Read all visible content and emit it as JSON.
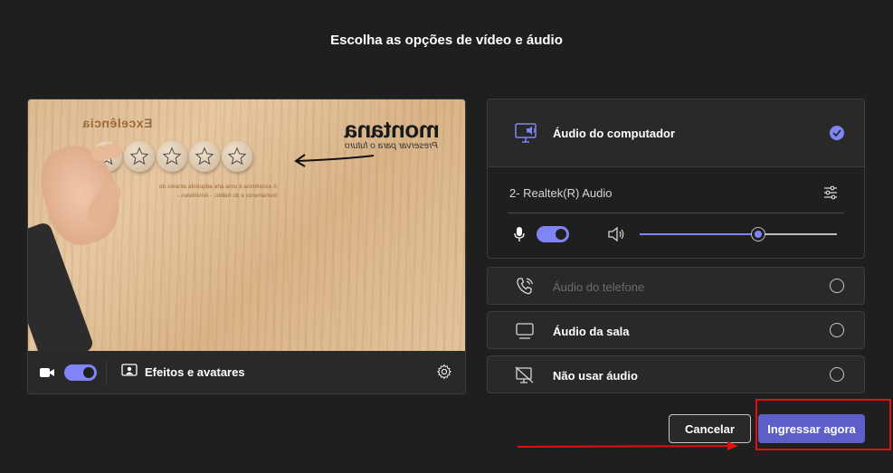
{
  "title": "Escolha as opções de vídeo e áudio",
  "video": {
    "preview_text": {
      "heading": "Excelência",
      "brand": "montana",
      "tagline": "Preservar para o futuro",
      "quote": "A excelência é uma arte adquirida através do treinamento e do hábito. - Aristóteles -"
    },
    "camera_toggle": "on",
    "effects_label": "Efeitos e avatares"
  },
  "audio": {
    "computer": {
      "label": "Áudio do computador",
      "selected": true
    },
    "device": "2- Realtek(R) Audio",
    "mic_toggle": "on",
    "speaker_volume": 0.6,
    "options": [
      {
        "label": "Áudio do telefone",
        "disabled": true,
        "icon": "phone-icon"
      },
      {
        "label": "Áudio da sala",
        "disabled": false,
        "icon": "room-icon"
      },
      {
        "label": "Não usar áudio",
        "disabled": false,
        "icon": "no-audio-icon"
      }
    ]
  },
  "buttons": {
    "cancel": "Cancelar",
    "join": "Ingressar agora"
  },
  "colors": {
    "accent": "#7f85f5",
    "primary_button": "#5b5fc7",
    "annotation": "#e01010"
  }
}
